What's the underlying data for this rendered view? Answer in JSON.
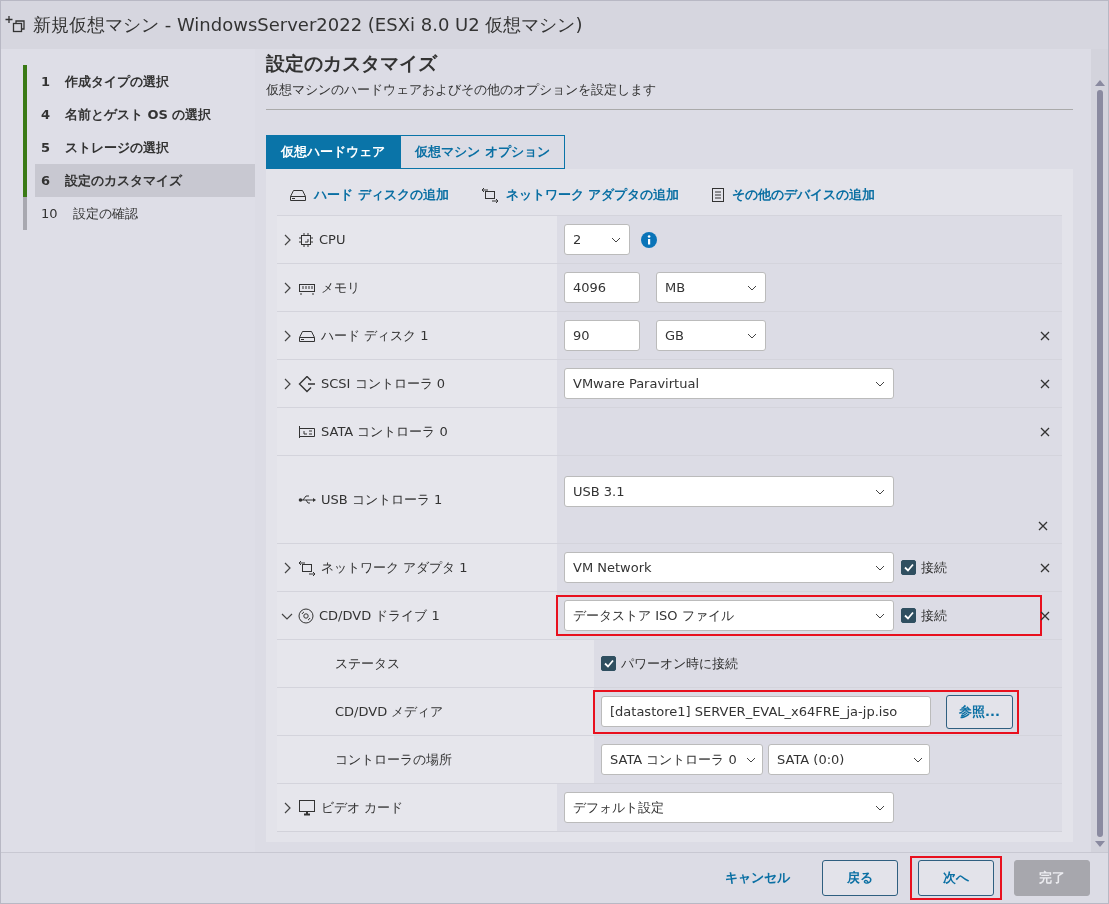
{
  "window": {
    "title": "新規仮想マシン - WindowsServer2022 (ESXi 8.0 U2 仮想マシン)"
  },
  "steps": [
    {
      "number": "1",
      "label": "作成タイプの選択",
      "visited": true,
      "selected": false
    },
    {
      "number": "4",
      "label": "名前とゲスト OS の選択",
      "visited": true,
      "selected": false
    },
    {
      "number": "5",
      "label": "ストレージの選択",
      "visited": true,
      "selected": false
    },
    {
      "number": "6",
      "label": "設定のカスタマイズ",
      "visited": true,
      "selected": true
    },
    {
      "number": "10",
      "label": "設定の確認",
      "visited": false,
      "selected": false
    }
  ],
  "page": {
    "heading": "設定のカスタマイズ",
    "subtitle": "仮想マシンのハードウェアおよびその他のオプションを設定します"
  },
  "tabs": [
    {
      "label": "仮想ハードウェア",
      "selected": true
    },
    {
      "label": "仮想マシン オプション",
      "selected": false
    }
  ],
  "toolbar": [
    {
      "kind": "disk",
      "label": "ハード ディスクの追加"
    },
    {
      "kind": "network",
      "label": "ネットワーク アダプタの追加"
    },
    {
      "kind": "device",
      "label": "その他のデバイスの追加"
    }
  ],
  "rows": [
    {
      "kind": "cpu",
      "label": "CPU",
      "expanded": false,
      "removable": false,
      "highlighted": false,
      "controls": [
        {
          "kind": "count-select",
          "value": "2"
        },
        {
          "kind": "info"
        }
      ]
    },
    {
      "kind": "memory",
      "label": "メモリ",
      "expanded": false,
      "removable": false,
      "highlighted": false,
      "controls": [
        {
          "kind": "number-input",
          "value": "4096"
        },
        {
          "kind": "unit-select",
          "value": "MB"
        }
      ]
    },
    {
      "kind": "disk",
      "label": "ハード ディスク 1",
      "expanded": false,
      "removable": true,
      "highlighted": false,
      "controls": [
        {
          "kind": "number-input",
          "value": "90"
        },
        {
          "kind": "unit-select",
          "value": "GB"
        }
      ]
    },
    {
      "kind": "scsi",
      "label": "SCSI コントローラ 0",
      "expanded": false,
      "removable": true,
      "highlighted": false,
      "controls": [
        {
          "kind": "select",
          "value": "VMware Paravirtual"
        }
      ]
    },
    {
      "kind": "sata",
      "label": "SATA コントローラ 0",
      "removable": true,
      "highlighted": false,
      "controls": []
    },
    {
      "kind": "usb",
      "label": "USB コントローラ 1",
      "removable": true,
      "highlighted": false,
      "tall": true,
      "controls": [
        {
          "kind": "select",
          "value": "USB 3.1"
        }
      ]
    },
    {
      "kind": "network",
      "label": "ネットワーク アダプタ 1",
      "expanded": false,
      "removable": true,
      "highlighted": false,
      "controls": [
        {
          "kind": "select",
          "value": "VM Network"
        },
        {
          "kind": "checkbox",
          "label": "接続",
          "checked": true
        }
      ]
    },
    {
      "kind": "cd",
      "label": "CD/DVD ドライブ 1",
      "expanded": true,
      "removable": true,
      "highlighted": true,
      "controls": [
        {
          "kind": "select",
          "value": "データストア ISO ファイル"
        },
        {
          "kind": "checkbox",
          "label": "接続",
          "checked": true
        }
      ]
    },
    {
      "kind": "setting",
      "label": "ステータス",
      "removable": false,
      "highlighted": false,
      "controls": [
        {
          "kind": "checkbox",
          "label": "パワーオン時に接続",
          "checked": true
        }
      ]
    },
    {
      "kind": "setting",
      "label": "CD/DVD メディア",
      "removable": false,
      "highlighted": true,
      "controls": [
        {
          "kind": "text-input",
          "value": "[datastore1] SERVER_EVAL_x64FRE_ja-jp.iso"
        },
        {
          "kind": "button",
          "label": "参照..."
        }
      ]
    },
    {
      "kind": "setting",
      "label": "コントローラの場所",
      "removable": false,
      "highlighted": false,
      "controls": [
        {
          "kind": "half-select",
          "value": "SATA コントローラ 0"
        },
        {
          "kind": "half-select",
          "value": "SATA (0:0)"
        }
      ]
    },
    {
      "kind": "monitor",
      "label": "ビデオ カード",
      "expanded": false,
      "removable": false,
      "highlighted": false,
      "controls": [
        {
          "kind": "select",
          "value": "デフォルト設定"
        }
      ]
    }
  ],
  "footer": [
    {
      "kind": "link",
      "label": "キャンセル",
      "highlighted": false,
      "disabled": false
    },
    {
      "kind": "outline",
      "label": "戻る",
      "highlighted": false,
      "disabled": false
    },
    {
      "kind": "outline",
      "label": "次へ",
      "highlighted": true,
      "disabled": false
    },
    {
      "kind": "solid",
      "label": "完了",
      "highlighted": false,
      "disabled": true
    }
  ]
}
